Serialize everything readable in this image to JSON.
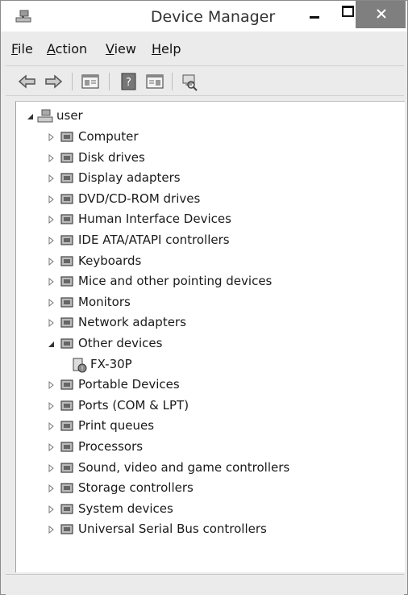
{
  "window": {
    "title": "Device Manager"
  },
  "menu": {
    "file": "File",
    "file_ul": "F",
    "file_rest": "ile",
    "action": "Action",
    "action_ul": "A",
    "action_rest": "ction",
    "view": "View",
    "view_ul": "V",
    "view_rest": "iew",
    "help": "Help",
    "help_ul": "H",
    "help_rest": "elp"
  },
  "toolbar": {
    "icons": [
      "back-arrow-icon",
      "forward-arrow-icon",
      "properties-icon",
      "help-icon",
      "update-driver-icon",
      "scan-hardware-icon"
    ]
  },
  "tree": {
    "root": "user",
    "categories": [
      {
        "label": "Computer",
        "expanded": false
      },
      {
        "label": "Disk drives",
        "expanded": false
      },
      {
        "label": "Display adapters",
        "expanded": false
      },
      {
        "label": "DVD/CD-ROM drives",
        "expanded": false
      },
      {
        "label": "Human Interface Devices",
        "expanded": false
      },
      {
        "label": "IDE ATA/ATAPI controllers",
        "expanded": false
      },
      {
        "label": "Keyboards",
        "expanded": false
      },
      {
        "label": "Mice and other pointing devices",
        "expanded": false
      },
      {
        "label": "Monitors",
        "expanded": false
      },
      {
        "label": "Network adapters",
        "expanded": false
      },
      {
        "label": "Other devices",
        "expanded": true
      },
      {
        "label": "Portable Devices",
        "expanded": false
      },
      {
        "label": "Ports (COM & LPT)",
        "expanded": false
      },
      {
        "label": "Print queues",
        "expanded": false
      },
      {
        "label": "Processors",
        "expanded": false
      },
      {
        "label": "Sound, video and game controllers",
        "expanded": false
      },
      {
        "label": "Storage controllers",
        "expanded": false
      },
      {
        "label": "System devices",
        "expanded": false
      },
      {
        "label": "Universal Serial Bus controllers",
        "expanded": false
      }
    ],
    "other_devices_child": "FX-30P"
  }
}
